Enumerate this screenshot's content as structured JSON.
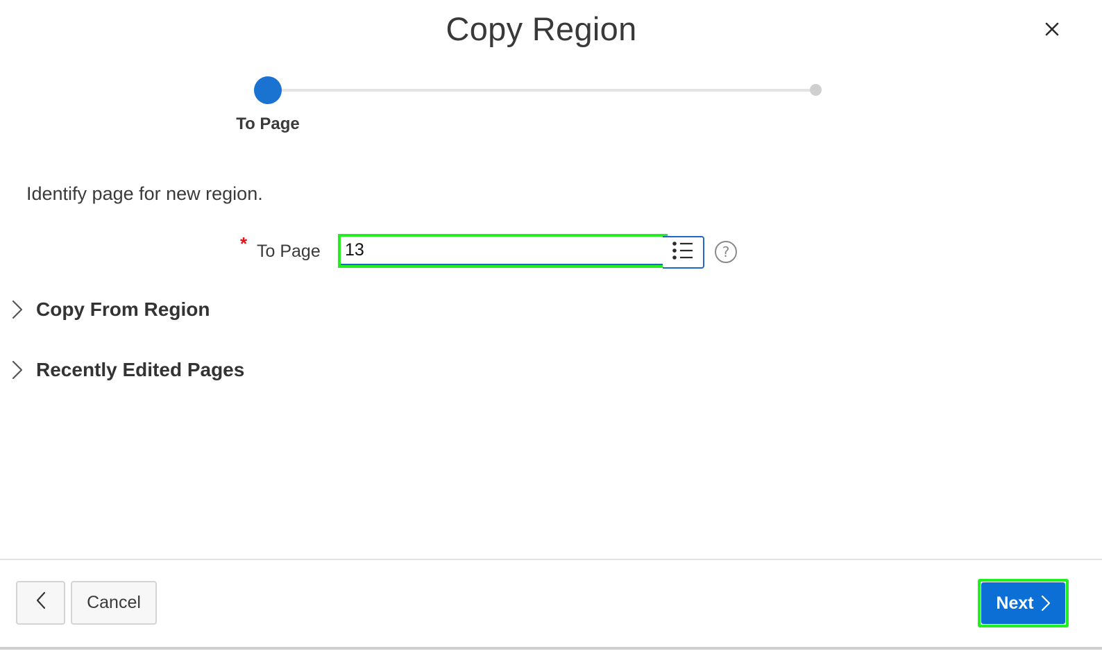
{
  "dialog": {
    "title": "Copy Region",
    "close_icon": "close-icon"
  },
  "wizard": {
    "steps": [
      {
        "label": "To Page",
        "state": "current"
      },
      {
        "label": "",
        "state": "upcoming"
      }
    ],
    "current_color": "#1a73d1"
  },
  "form": {
    "instruction": "Identify page for new region.",
    "required_marker": "*",
    "to_page": {
      "label": "To Page",
      "value": "13",
      "lov_icon": "list-icon",
      "help_icon": "help-icon",
      "help_glyph": "?"
    }
  },
  "sections": [
    {
      "title": "Copy From Region",
      "icon": "chevron-right-icon",
      "expanded": false
    },
    {
      "title": "Recently Edited Pages",
      "icon": "chevron-right-icon",
      "expanded": false
    }
  ],
  "footer": {
    "back_icon": "chevron-left-icon",
    "cancel_label": "Cancel",
    "next_label": "Next",
    "next_icon": "chevron-right-icon",
    "primary_color": "#0b6fd6"
  }
}
